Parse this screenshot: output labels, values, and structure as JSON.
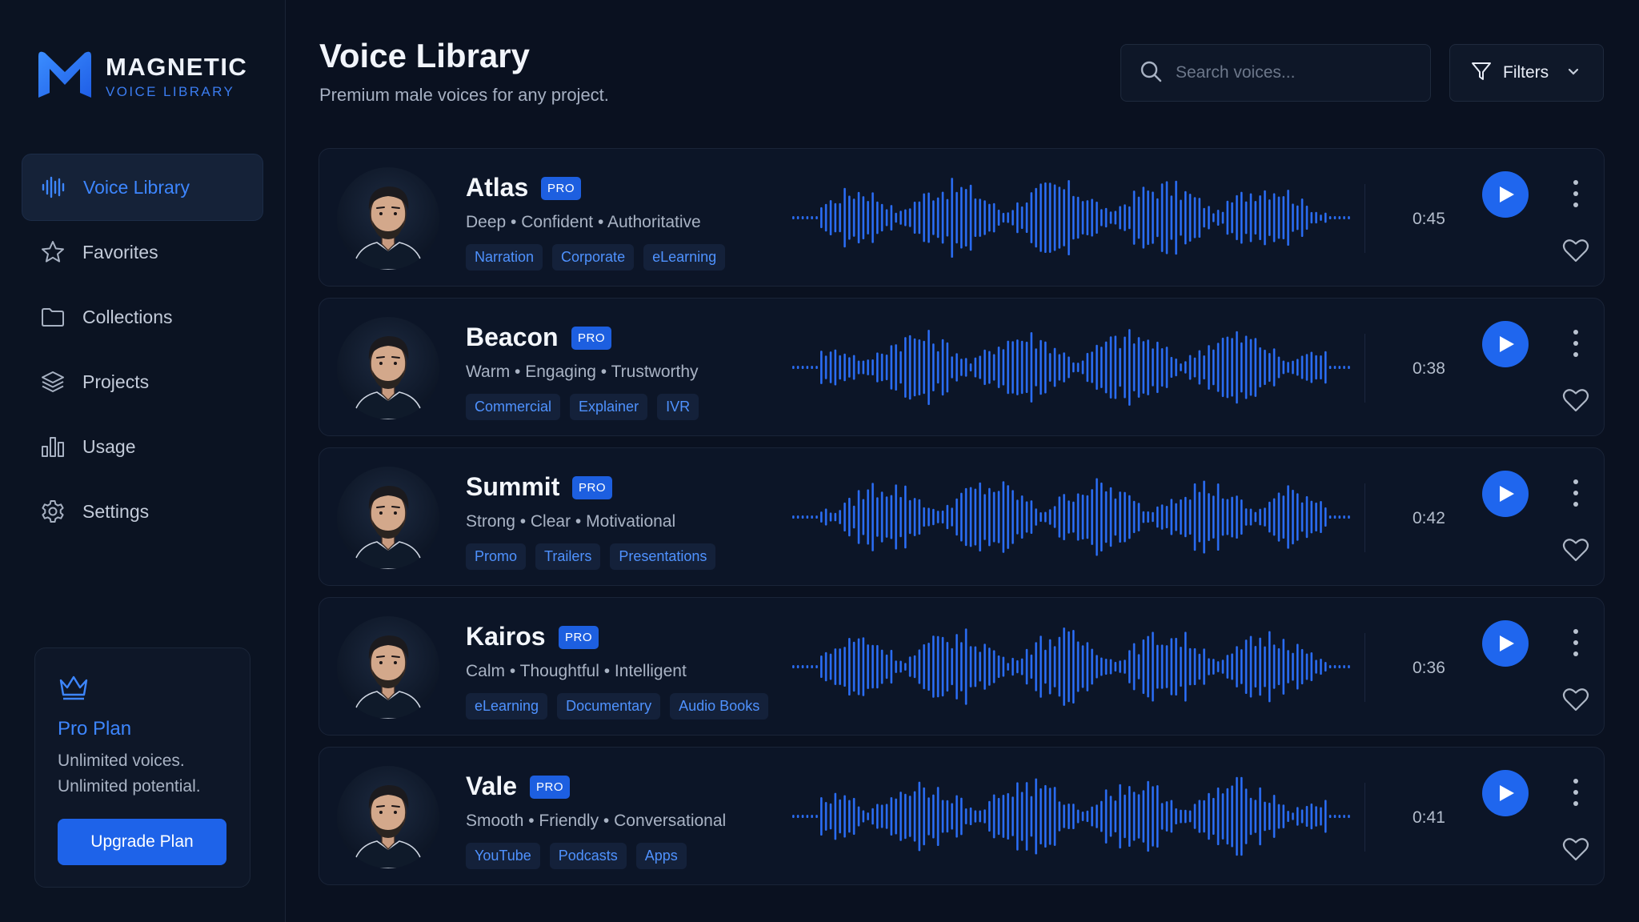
{
  "brand": {
    "name": "MAGNETIC",
    "subtitle": "VOICE LIBRARY"
  },
  "sidebar": {
    "items": [
      {
        "label": "Voice Library",
        "icon": "waveform-icon",
        "active": true
      },
      {
        "label": "Favorites",
        "icon": "star-icon"
      },
      {
        "label": "Collections",
        "icon": "folder-icon"
      },
      {
        "label": "Projects",
        "icon": "layers-icon"
      },
      {
        "label": "Usage",
        "icon": "bar-chart-icon"
      },
      {
        "label": "Settings",
        "icon": "gear-icon"
      }
    ],
    "pro_card": {
      "icon": "crown-icon",
      "title": "Pro Plan",
      "description": "Unlimited voices. Unlimited potential.",
      "button": "Upgrade Plan"
    }
  },
  "header": {
    "title": "Voice Library",
    "subtitle": "Premium male voices for any project.",
    "search_placeholder": "Search voices...",
    "filters_label": "Filters"
  },
  "voices": [
    {
      "name": "Atlas",
      "badge": "PRO",
      "traits": "Deep • Confident • Authoritative",
      "tags": [
        "Narration",
        "Corporate",
        "eLearning"
      ],
      "duration": "0:45"
    },
    {
      "name": "Beacon",
      "badge": "PRO",
      "traits": "Warm • Engaging • Trustworthy",
      "tags": [
        "Commercial",
        "Explainer",
        "IVR"
      ],
      "duration": "0:38"
    },
    {
      "name": "Summit",
      "badge": "PRO",
      "traits": "Strong • Clear • Motivational",
      "tags": [
        "Promo",
        "Trailers",
        "Presentations"
      ],
      "duration": "0:42"
    },
    {
      "name": "Kairos",
      "badge": "PRO",
      "traits": "Calm • Thoughtful • Intelligent",
      "tags": [
        "eLearning",
        "Documentary",
        "Audio Books"
      ],
      "duration": "0:36"
    },
    {
      "name": "Vale",
      "badge": "PRO",
      "traits": "Smooth • Friendly • Conversational",
      "tags": [
        "YouTube",
        "Podcasts",
        "Apps"
      ],
      "duration": "0:41"
    }
  ],
  "colors": {
    "accent": "#1f66ee",
    "accent_text": "#3d86ff",
    "background": "#0a1120",
    "card": "#0c1527",
    "waveform": "#2a6cf2"
  }
}
